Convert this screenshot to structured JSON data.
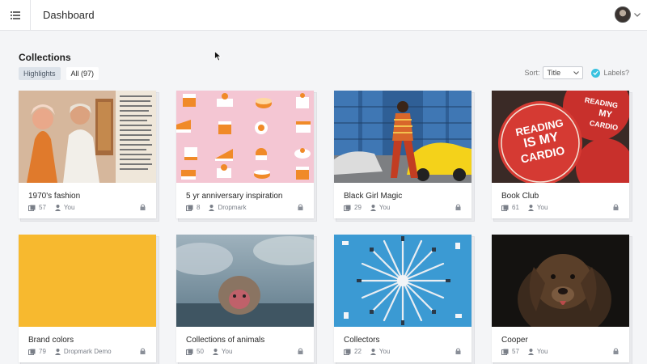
{
  "header": {
    "title": "Dashboard",
    "menu_icon": "list-icon",
    "avatar_icon": "user-avatar",
    "dropdown_icon": "chevron-down-icon"
  },
  "section": {
    "title": "Collections",
    "filters": [
      {
        "label": "Highlights",
        "active": true
      },
      {
        "label": "All (97)",
        "active": false
      }
    ],
    "sort_label": "Sort:",
    "sort_value": "Title",
    "labels_toggle": "Labels?"
  },
  "collections": [
    {
      "title": "1970's fashion",
      "count": "57",
      "owner": "You",
      "thumb": "fashion-photo"
    },
    {
      "title": "5 yr anniversary inspiration",
      "count": "8",
      "owner": "Dropmark",
      "thumb": "cakes-pattern"
    },
    {
      "title": "Black Girl Magic",
      "count": "29",
      "owner": "You",
      "thumb": "street-photo"
    },
    {
      "title": "Book Club",
      "count": "61",
      "owner": "You",
      "thumb": "buttons-photo"
    },
    {
      "title": "Brand colors",
      "count": "79",
      "owner": "Dropmark Demo",
      "thumb": "yellow-swatch"
    },
    {
      "title": "Collections of animals",
      "count": "50",
      "owner": "You",
      "thumb": "monkey-photo"
    },
    {
      "title": "Collectors",
      "count": "22",
      "owner": "You",
      "thumb": "tools-photo"
    },
    {
      "title": "Cooper",
      "count": "57",
      "owner": "You",
      "thumb": "dog-photo"
    }
  ],
  "buttons_text": {
    "reading1": "READING",
    "my1": "MY",
    "cardio1": "CARDIO",
    "is": "IS MY",
    "cardio2": "CARDIO"
  },
  "colors": {
    "accent": "#39c2e0",
    "swatch_yellow": "#f7b92f",
    "cakes_bg": "#f4c6d3",
    "tools_bg": "#3b9ad3"
  }
}
